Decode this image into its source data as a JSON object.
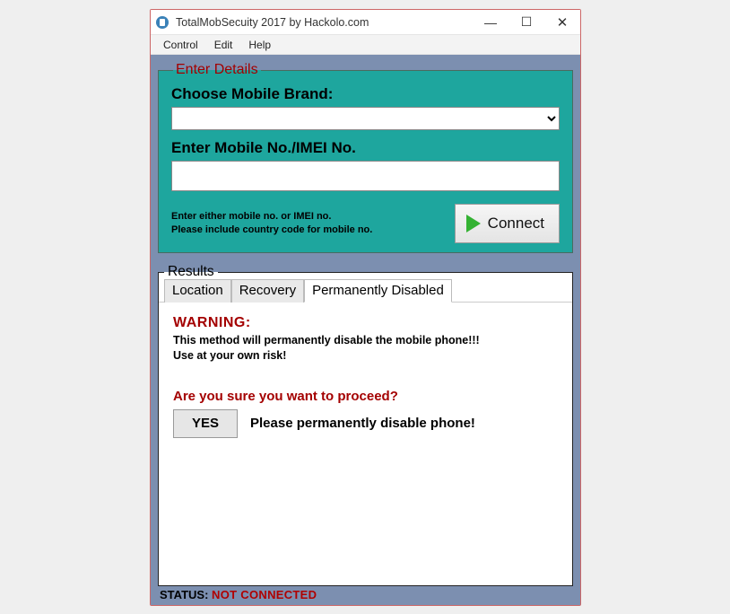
{
  "window": {
    "title": "TotalMobSecuity 2017 by Hackolo.com"
  },
  "menu": {
    "control": "Control",
    "edit": "Edit",
    "help": "Help"
  },
  "details": {
    "legend": "Enter Details",
    "brand_label": "Choose Mobile Brand:",
    "brand_value": "",
    "imei_label": "Enter Mobile No./IMEI No.",
    "imei_value": "",
    "hint_line1": "Enter either mobile no. or IMEI no.",
    "hint_line2": "Please include country code for mobile no.",
    "connect_label": "Connect"
  },
  "results": {
    "legend": "Results",
    "tabs": {
      "location": "Location",
      "recovery": "Recovery",
      "disabled": "Permanently Disabled"
    },
    "warning_head": "WARNING:",
    "warning_l1": "This method will permanently disable the mobile phone!!!",
    "warning_l2": "Use at your own risk!",
    "confirm": "Are you sure you want to proceed?",
    "yes_label": "YES",
    "yes_text": "Please permanently disable phone!"
  },
  "status": {
    "label": "STATUS:",
    "value": "NOT CONNECTED"
  }
}
